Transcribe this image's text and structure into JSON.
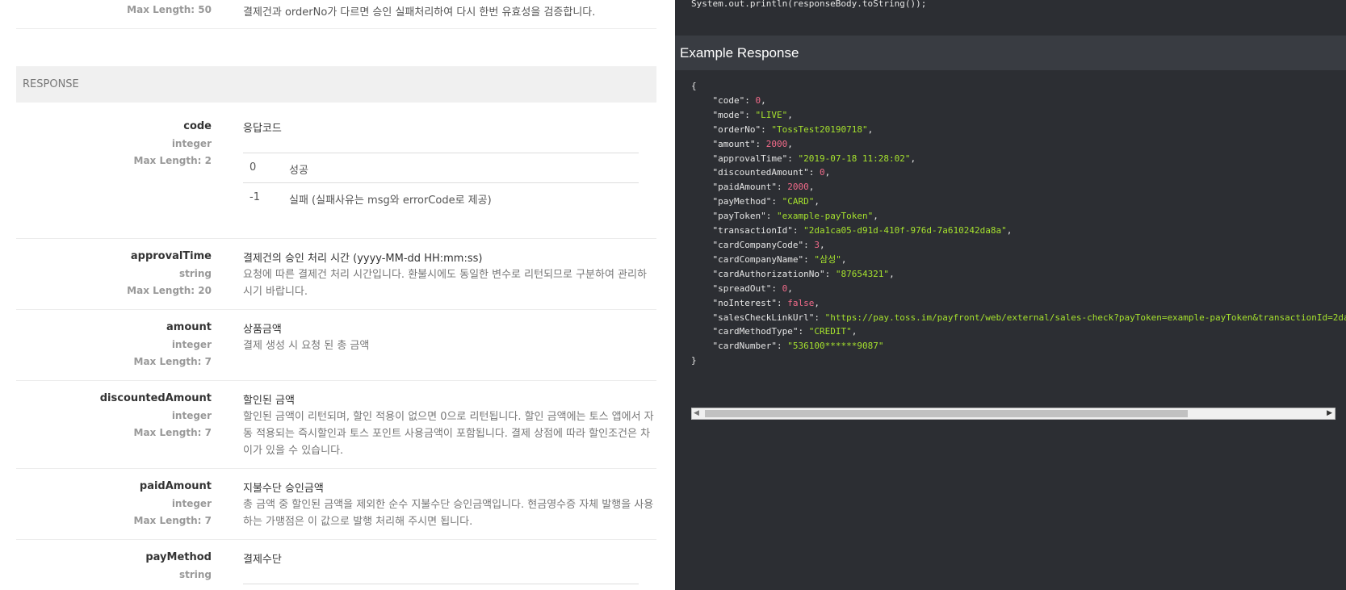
{
  "top_row": {
    "type_line": "Max Length: 50",
    "desc": "결제건과 orderNo가 다르면 승인 실패처리하여 다시 한번 유효성을 검증합니다."
  },
  "response_header": "RESPONSE",
  "params": [
    {
      "name": "code",
      "type": "integer",
      "maxlen": "Max Length: 2",
      "title": "응답코드",
      "desc": "",
      "codes": [
        {
          "value": "0",
          "label": "성공"
        },
        {
          "value": "-1",
          "label": "실패 (실패사유는 msg와 errorCode로 제공)"
        }
      ]
    },
    {
      "name": "approvalTime",
      "type": "string",
      "maxlen": "Max Length: 20",
      "title": "결제건의 승인 처리 시간 (yyyy-MM-dd HH:mm:ss)",
      "desc": "요청에 따른 결제건 처리 시간입니다. 환불시에도 동일한 변수로 리턴되므로 구분하여 관리하시기 바랍니다."
    },
    {
      "name": "amount",
      "type": "integer",
      "maxlen": "Max Length: 7",
      "title": "상품금액",
      "desc": "결제 생성 시 요청 된 총 금액"
    },
    {
      "name": "discountedAmount",
      "type": "integer",
      "maxlen": "Max Length: 7",
      "title": "할인된 금액",
      "desc": "할인된 금액이 리턴되며, 할인 적용이 없으면 0으로 리턴됩니다. 할인 금액에는 토스 앱에서 자동 적용되는 즉시할인과 토스 포인트 사용금액이 포함됩니다. 결제 상점에 따라 할인조건은 차이가 있을 수 있습니다."
    },
    {
      "name": "paidAmount",
      "type": "integer",
      "maxlen": "Max Length: 7",
      "title": "지불수단 승인금액",
      "desc": "총 금액 중 할인된 금액을 제외한 순수 지불수단 승인금액입니다. 현금영수증 자체 발행을 사용하는 가맹점은 이 값으로 발행 처리해 주시면 됩니다."
    },
    {
      "name": "payMethod",
      "type": "string",
      "maxlen": "",
      "title": "결제수단",
      "desc": ""
    }
  ],
  "code_top": "System.out.println(responseBody.toString());",
  "example": {
    "title": "Example Response",
    "open_brace": "{",
    "close_brace": "}",
    "lines": [
      {
        "k": "\"code\"",
        "v": "0",
        "t": "n"
      },
      {
        "k": "\"mode\"",
        "v": "\"LIVE\"",
        "t": "s"
      },
      {
        "k": "\"orderNo\"",
        "v": "\"TossTest20190718\"",
        "t": "s"
      },
      {
        "k": "\"amount\"",
        "v": "2000",
        "t": "n"
      },
      {
        "k": "\"approvalTime\"",
        "v": "\"2019-07-18 11:28:02\"",
        "t": "s"
      },
      {
        "k": "\"discountedAmount\"",
        "v": "0",
        "t": "n"
      },
      {
        "k": "\"paidAmount\"",
        "v": "2000",
        "t": "n"
      },
      {
        "k": "\"payMethod\"",
        "v": "\"CARD\"",
        "t": "s"
      },
      {
        "k": "\"payToken\"",
        "v": "\"example-payToken\"",
        "t": "s"
      },
      {
        "k": "\"transactionId\"",
        "v": "\"2da1ca05-d91d-410f-976d-7a610242da8a\"",
        "t": "s"
      },
      {
        "k": "\"cardCompanyCode\"",
        "v": "3",
        "t": "n"
      },
      {
        "k": "\"cardCompanyName\"",
        "v": "\"삼성\"",
        "t": "s"
      },
      {
        "k": "\"cardAuthorizationNo\"",
        "v": "\"87654321\"",
        "t": "s"
      },
      {
        "k": "\"spreadOut\"",
        "v": "0",
        "t": "n"
      },
      {
        "k": "\"noInterest\"",
        "v": "false",
        "t": "b"
      },
      {
        "k": "\"salesCheckLinkUrl\"",
        "v": "\"https://pay.toss.im/payfront/web/external/sales-check?payToken=example-payToken&transactionId=2da",
        "t": "s"
      },
      {
        "k": "\"cardMethodType\"",
        "v": "\"CREDIT\"",
        "t": "s"
      },
      {
        "k": "\"cardNumber\"",
        "v": "\"536100******9087\"",
        "t": "s",
        "last": true
      }
    ]
  },
  "colors": {
    "code_bg": "#2c2e33",
    "header_bg": "#393c42",
    "string": "#a6e22e",
    "number": "#f26b8a"
  }
}
